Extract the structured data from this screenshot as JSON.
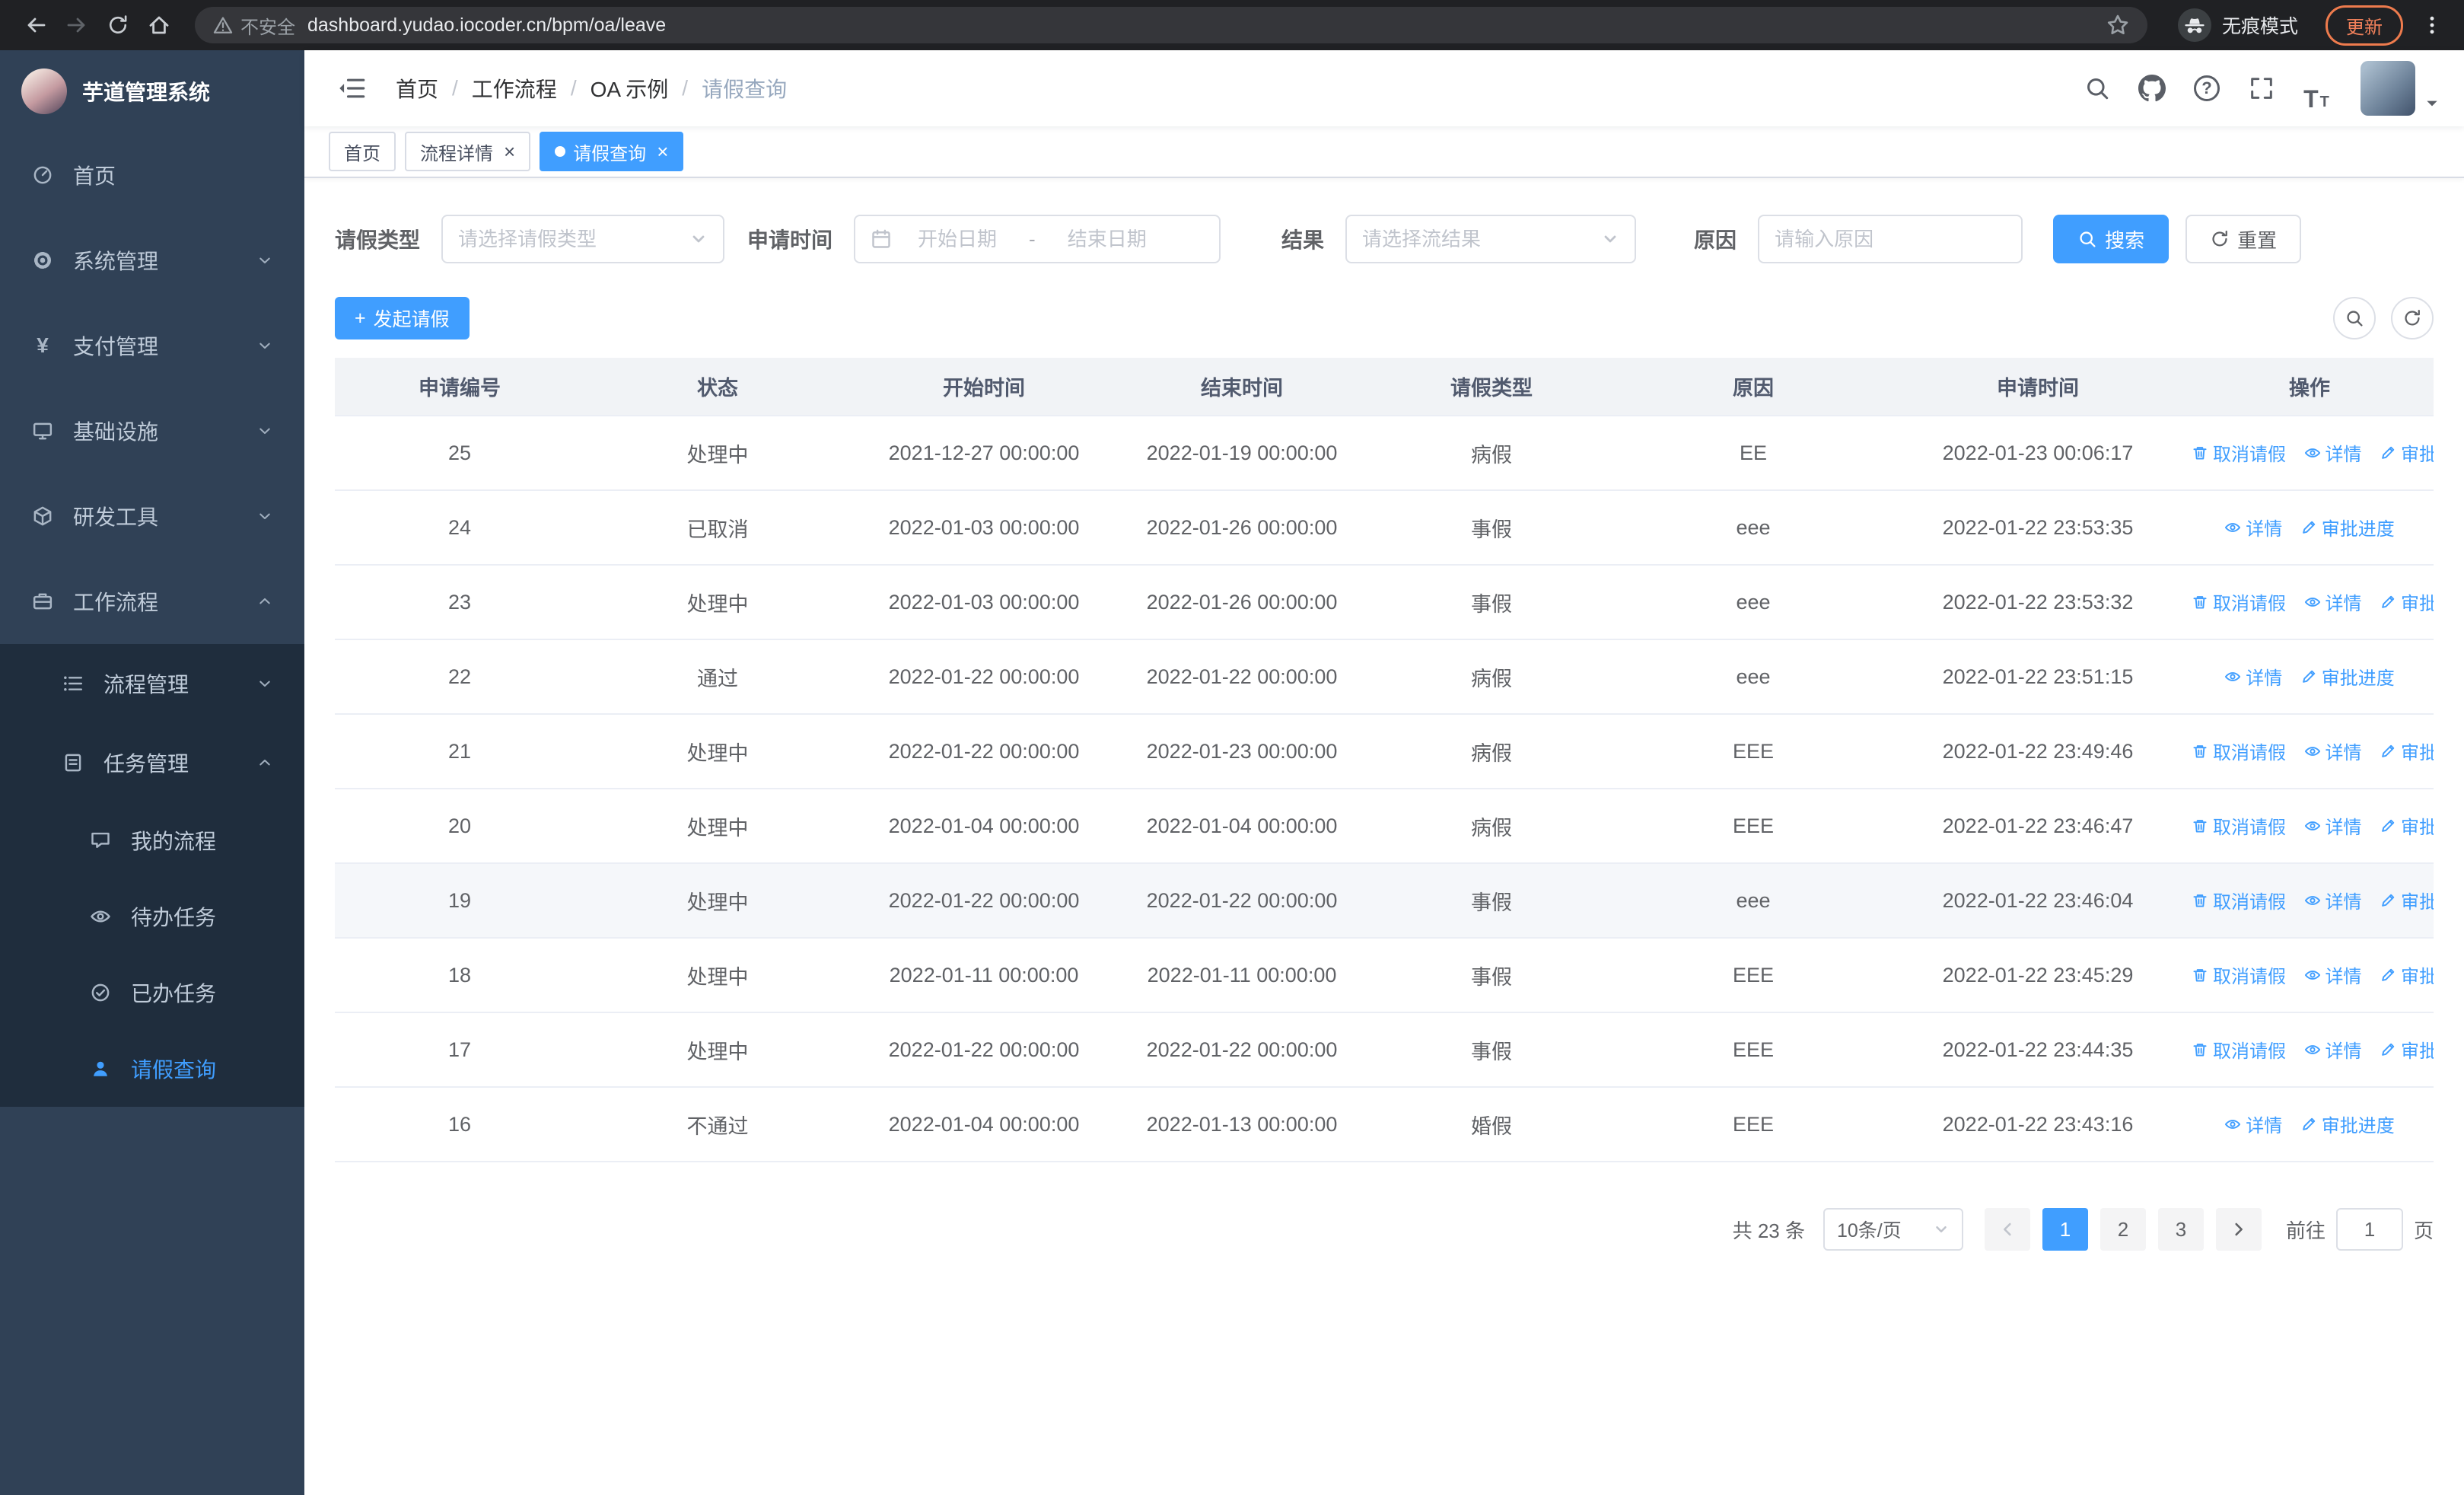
{
  "browser": {
    "security_label": "不安全",
    "url": "dashboard.yudao.iocoder.cn/bpm/oa/leave",
    "incognito_label": "无痕模式",
    "update_label": "更新"
  },
  "icons": {
    "close": "×",
    "yen": "¥",
    "plus": "+",
    "help": "?",
    "t_large": "T",
    "t_small": "T"
  },
  "sidebar": {
    "app_title": "芋道管理系统",
    "menu": [
      {
        "label": "首页"
      },
      {
        "label": "系统管理"
      },
      {
        "label": "支付管理"
      },
      {
        "label": "基础设施"
      },
      {
        "label": "研发工具"
      },
      {
        "label": "工作流程"
      }
    ],
    "workflow_submenu": [
      {
        "label": "流程管理"
      },
      {
        "label": "任务管理"
      }
    ],
    "task_submenu": [
      {
        "label": "我的流程"
      },
      {
        "label": "待办任务"
      },
      {
        "label": "已办任务"
      },
      {
        "label": "请假查询"
      }
    ]
  },
  "header": {
    "breadcrumb": [
      "首页",
      "工作流程",
      "OA 示例",
      "请假查询"
    ],
    "breadcrumb_separator": "/"
  },
  "tabs": [
    {
      "label": "首页",
      "closable": false
    },
    {
      "label": "流程详情",
      "closable": true
    },
    {
      "label": "请假查询",
      "closable": true,
      "_class": "active"
    }
  ],
  "filters": {
    "leave_type_label": "请假类型",
    "leave_type_placeholder": "请选择请假类型",
    "apply_time_label": "申请时间",
    "start_date_placeholder": "开始日期",
    "range_separator": "-",
    "end_date_placeholder": "结束日期",
    "result_label": "结果",
    "result_placeholder": "请选择流结果",
    "reason_label": "原因",
    "reason_placeholder": "请输入原因",
    "search_button": "搜索",
    "reset_button": "重置"
  },
  "toolbar": {
    "create_button": "发起请假"
  },
  "table": {
    "columns": [
      "申请编号",
      "状态",
      "开始时间",
      "结束时间",
      "请假类型",
      "原因",
      "申请时间",
      "操作"
    ],
    "actions": {
      "cancel": "取消请假",
      "detail": "详情",
      "progress": "审批进度"
    },
    "rows": [
      {
        "id": "25",
        "status": "处理中",
        "start": "2021-12-27 00:00:00",
        "end": "2022-01-19 00:00:00",
        "type": "病假",
        "reason": "EE",
        "applied": "2022-01-23 00:06:17",
        "can_cancel": true
      },
      {
        "id": "24",
        "status": "已取消",
        "start": "2022-01-03 00:00:00",
        "end": "2022-01-26 00:00:00",
        "type": "事假",
        "reason": "eee",
        "applied": "2022-01-22 23:53:35",
        "can_cancel": false
      },
      {
        "id": "23",
        "status": "处理中",
        "start": "2022-01-03 00:00:00",
        "end": "2022-01-26 00:00:00",
        "type": "事假",
        "reason": "eee",
        "applied": "2022-01-22 23:53:32",
        "can_cancel": true
      },
      {
        "id": "22",
        "status": "通过",
        "start": "2022-01-22 00:00:00",
        "end": "2022-01-22 00:00:00",
        "type": "病假",
        "reason": "eee",
        "applied": "2022-01-22 23:51:15",
        "can_cancel": false
      },
      {
        "id": "21",
        "status": "处理中",
        "start": "2022-01-22 00:00:00",
        "end": "2022-01-23 00:00:00",
        "type": "病假",
        "reason": "EEE",
        "applied": "2022-01-22 23:49:46",
        "can_cancel": true
      },
      {
        "id": "20",
        "status": "处理中",
        "start": "2022-01-04 00:00:00",
        "end": "2022-01-04 00:00:00",
        "type": "病假",
        "reason": "EEE",
        "applied": "2022-01-22 23:46:47",
        "can_cancel": true
      },
      {
        "id": "19",
        "status": "处理中",
        "start": "2022-01-22 00:00:00",
        "end": "2022-01-22 00:00:00",
        "type": "事假",
        "reason": "eee",
        "applied": "2022-01-22 23:46:04",
        "can_cancel": true,
        "_class": "highlighted"
      },
      {
        "id": "18",
        "status": "处理中",
        "start": "2022-01-11 00:00:00",
        "end": "2022-01-11 00:00:00",
        "type": "事假",
        "reason": "EEE",
        "applied": "2022-01-22 23:45:29",
        "can_cancel": true
      },
      {
        "id": "17",
        "status": "处理中",
        "start": "2022-01-22 00:00:00",
        "end": "2022-01-22 00:00:00",
        "type": "事假",
        "reason": "EEE",
        "applied": "2022-01-22 23:44:35",
        "can_cancel": true
      },
      {
        "id": "16",
        "status": "不通过",
        "start": "2022-01-04 00:00:00",
        "end": "2022-01-13 00:00:00",
        "type": "婚假",
        "reason": "EEE",
        "applied": "2022-01-22 23:43:16",
        "can_cancel": false
      }
    ]
  },
  "pagination": {
    "total_label": "共 23 条",
    "page_size": "10条/页",
    "pages": [
      {
        "label": "1",
        "_class": "active"
      },
      {
        "label": "2"
      },
      {
        "label": "3"
      }
    ],
    "goto_label": "前往",
    "goto_value": "1",
    "goto_unit": "页"
  },
  "colors": {
    "primary": "#409eff",
    "sidebar_bg": "#304156",
    "submenu_bg": "#1f2d3d"
  }
}
